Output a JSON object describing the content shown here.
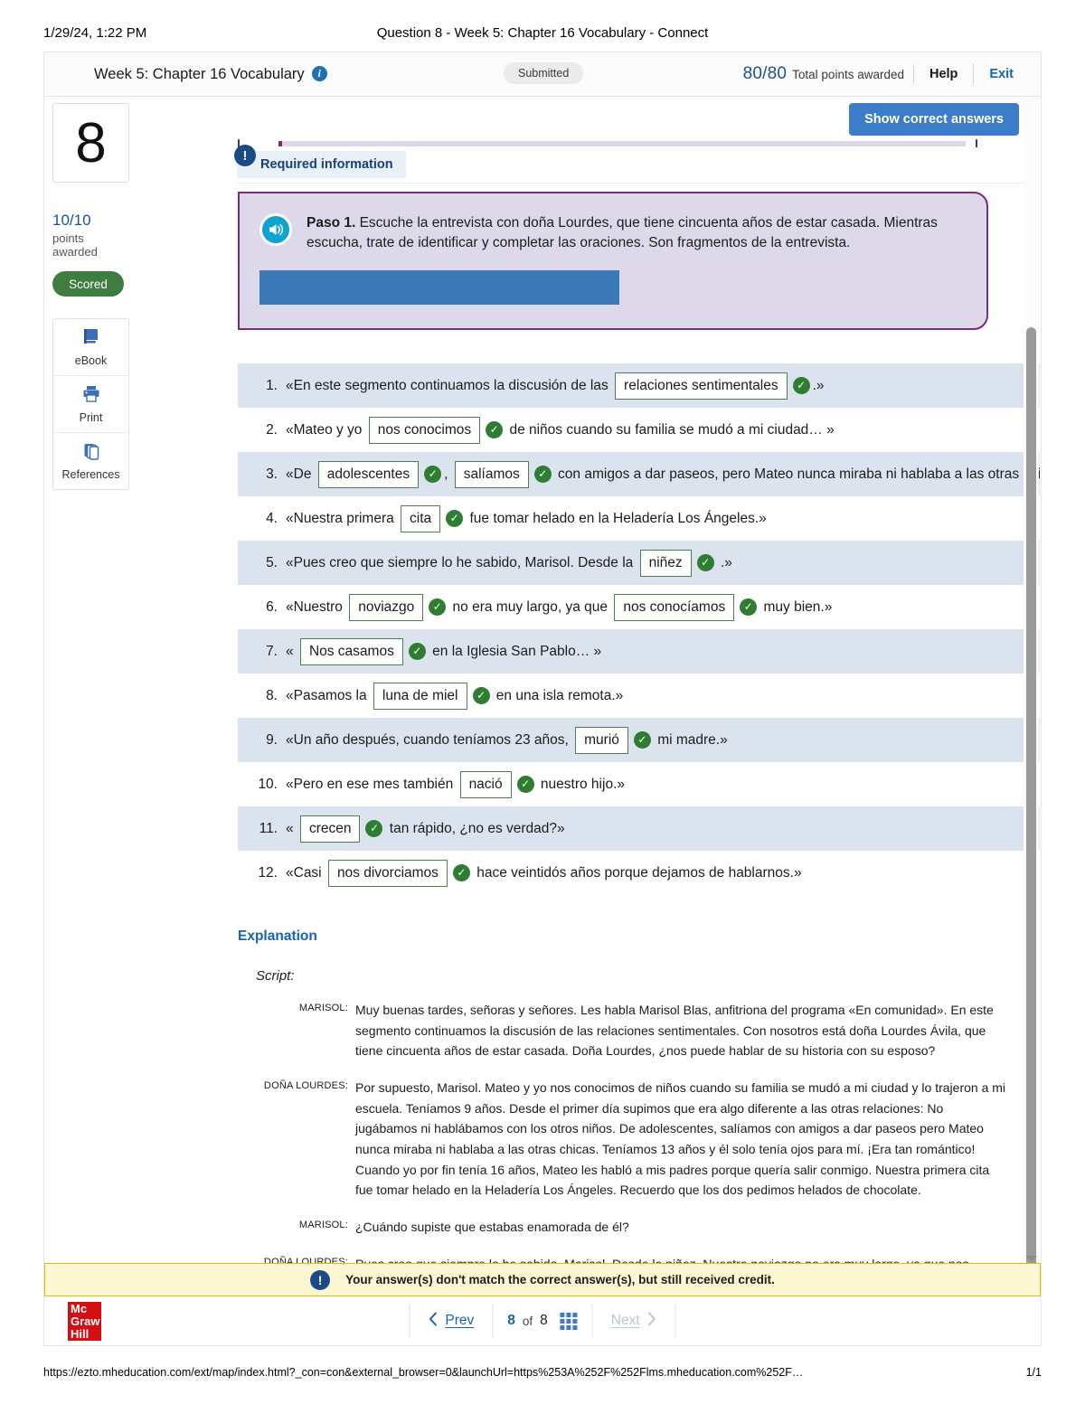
{
  "print_header": {
    "date": "1/29/24, 1:22 PM",
    "title": "Question 8 - Week 5: Chapter 16 Vocabulary - Connect"
  },
  "topbar": {
    "assignment_title": "Week 5: Chapter 16 Vocabulary",
    "info_icon": "info-icon",
    "status_pill": "Submitted",
    "points_fraction": "80/80",
    "points_label": "Total points awarded",
    "help_label": "Help",
    "exit_label": "Exit"
  },
  "rail": {
    "question_number": "8",
    "points_awarded": "10/10",
    "points_awarded_sub": "points awarded",
    "scored_label": "Scored",
    "tools": [
      {
        "label": "eBook",
        "icon": "book-icon"
      },
      {
        "label": "Print",
        "icon": "printer-icon"
      },
      {
        "label": "References",
        "icon": "copy-pages-icon"
      }
    ]
  },
  "content": {
    "show_answers_label": "Show correct answers",
    "required_info_label": "Required information",
    "required_info_icon": "exclamation-icon",
    "paso": {
      "audio_icon": "speaker-icon",
      "lead": "Paso 1.",
      "text": " Escuche la entrevista con doña Lourdes, que tiene cincuenta años de estar casada. Mientras escucha, trate de identificar y completar las oraciones. Son fragmentos de la entrevista."
    }
  },
  "questions": [
    {
      "num": "1.",
      "parts": [
        {
          "t": "text",
          "v": "«En este segmento continuamos la discusión de las "
        },
        {
          "t": "box",
          "v": "relaciones sentimentales"
        },
        {
          "t": "check",
          "v": "✓"
        },
        {
          "t": "text",
          "v": ".»"
        }
      ]
    },
    {
      "num": "2.",
      "parts": [
        {
          "t": "text",
          "v": "«Mateo y yo "
        },
        {
          "t": "box",
          "v": "nos conocimos"
        },
        {
          "t": "check",
          "v": "✓"
        },
        {
          "t": "text",
          "v": " de niños cuando su familia se mudó a mi ciudad… »"
        }
      ]
    },
    {
      "num": "3.",
      "parts": [
        {
          "t": "text",
          "v": "«De "
        },
        {
          "t": "box",
          "v": "adolescentes"
        },
        {
          "t": "check",
          "v": "✓"
        },
        {
          "t": "text",
          "v": ", "
        },
        {
          "t": "box",
          "v": "salíamos"
        },
        {
          "t": "check",
          "v": "✓"
        },
        {
          "t": "text",
          "v": " con amigos a dar paseos, pero Mateo nunca miraba ni hablaba a las otras chicas.»"
        }
      ]
    },
    {
      "num": "4.",
      "parts": [
        {
          "t": "text",
          "v": "«Nuestra primera "
        },
        {
          "t": "box",
          "v": "cita"
        },
        {
          "t": "check",
          "v": "✓"
        },
        {
          "t": "text",
          "v": " fue tomar helado en la Heladería Los Ángeles.»"
        }
      ]
    },
    {
      "num": "5.",
      "parts": [
        {
          "t": "text",
          "v": "«Pues creo que siempre lo he sabido, Marisol. Desde la "
        },
        {
          "t": "box",
          "v": "niñez"
        },
        {
          "t": "check",
          "v": "✓"
        },
        {
          "t": "text",
          "v": " .»"
        }
      ]
    },
    {
      "num": "6.",
      "parts": [
        {
          "t": "text",
          "v": "«Nuestro "
        },
        {
          "t": "box",
          "v": "noviazgo"
        },
        {
          "t": "check",
          "v": "✓"
        },
        {
          "t": "text",
          "v": " no era muy largo, ya que "
        },
        {
          "t": "box",
          "v": "nos conocíamos"
        },
        {
          "t": "check",
          "v": "✓"
        },
        {
          "t": "text",
          "v": " muy bien.»"
        }
      ]
    },
    {
      "num": "7.",
      "parts": [
        {
          "t": "text",
          "v": "« "
        },
        {
          "t": "box",
          "v": "Nos casamos"
        },
        {
          "t": "check",
          "v": "✓"
        },
        {
          "t": "text",
          "v": " en la Iglesia San Pablo… »"
        }
      ]
    },
    {
      "num": "8.",
      "parts": [
        {
          "t": "text",
          "v": "«Pasamos la "
        },
        {
          "t": "box",
          "v": "luna de miel"
        },
        {
          "t": "check",
          "v": "✓"
        },
        {
          "t": "text",
          "v": " en una isla remota.»"
        }
      ]
    },
    {
      "num": "9.",
      "parts": [
        {
          "t": "text",
          "v": "«Un año después, cuando teníamos 23 años, "
        },
        {
          "t": "box",
          "v": "murió"
        },
        {
          "t": "check",
          "v": "✓"
        },
        {
          "t": "text",
          "v": " mi madre.»"
        }
      ]
    },
    {
      "num": "10.",
      "parts": [
        {
          "t": "text",
          "v": "«Pero en ese mes también "
        },
        {
          "t": "box",
          "v": "nació"
        },
        {
          "t": "check",
          "v": "✓"
        },
        {
          "t": "text",
          "v": " nuestro hijo.»"
        }
      ]
    },
    {
      "num": "11.",
      "parts": [
        {
          "t": "text",
          "v": "« "
        },
        {
          "t": "box",
          "v": "crecen"
        },
        {
          "t": "check",
          "v": "✓"
        },
        {
          "t": "text",
          "v": " tan rápido, ¿no es verdad?»"
        }
      ]
    },
    {
      "num": "12.",
      "parts": [
        {
          "t": "text",
          "v": "«Casi "
        },
        {
          "t": "box",
          "v": "nos divorciamos"
        },
        {
          "t": "check",
          "v": "✓"
        },
        {
          "t": "text",
          "v": " hace veintidós años porque dejamos de hablarnos.»"
        }
      ]
    }
  ],
  "explanation": {
    "title": "Explanation",
    "script_label": "Script:",
    "entries": [
      {
        "speaker": "MARISOL:",
        "speech": "Muy buenas tardes, señoras y señores. Les habla Marisol Blas, anfitriona del programa «En comunidad». En este segmento continuamos la discusión de las relaciones sentimentales. Con nosotros está doña Lourdes Ávila, que tiene cincuenta años de estar casada. Doña Lourdes, ¿nos puede hablar de su historia con su esposo?"
      },
      {
        "speaker": "DOÑA LOURDES:",
        "speech": "Por supuesto, Marisol. Mateo y yo nos conocimos de niños cuando su familia se mudó a mi ciudad y lo trajeron a mi escuela. Teníamos 9 años. Desde el primer día supimos que era algo diferente a las otras relaciones: No jugábamos ni hablábamos con los otros niños. De adolescentes, salíamos con amigos a dar paseos pero Mateo nunca miraba ni hablaba a las otras chicas. Teníamos 13 años y él solo tenía ojos para mí. ¡Era tan romántico! Cuando yo por fin tenía 16 años, Mateo les habló a mis padres porque quería salir conmigo. Nuestra primera cita fue tomar helado en la Heladería Los Ángeles. Recuerdo que los dos pedimos helados de chocolate."
      },
      {
        "speaker": "MARISOL:",
        "speech": "¿Cuándo supiste que estabas enamorada de él?"
      },
      {
        "speaker": "DOÑA LOURDES:",
        "speech": "Pues creo que siempre lo he sabido, Marisol. Desde la niñez. Nuestro noviazgo no era muy largo, ya que nos"
      }
    ]
  },
  "warning": {
    "icon": "exclamation-icon",
    "text": "Your answer(s) don't match the correct answer(s), but still received credit."
  },
  "footer": {
    "logo_lines": "Mc\nGraw\nHill",
    "prev_label": "Prev",
    "next_label": "Next",
    "page_current": "8",
    "page_of": "of",
    "page_total": "8",
    "grid_icon": "grid-icon"
  },
  "print_footer": {
    "url": "https://ezto.mheducation.com/ext/map/index.html?_con=con&external_browser=0&launchUrl=https%253A%252F%252Flms.mheducation.com%252F…",
    "page": "1/1"
  },
  "colors": {
    "accent_blue": "#3d7cc9",
    "link_blue": "#1763b0",
    "points_blue": "#1f4e9c",
    "scored_green": "#3f7c3f",
    "check_green": "#2f7d32",
    "paso_border": "#7c2b7c",
    "paso_bg": "#ddd9ea",
    "row_alt": "#dbe4ee",
    "warn_bg": "#fdf6d3",
    "warn_border": "#e0c200",
    "mh_red": "#d40f14"
  }
}
